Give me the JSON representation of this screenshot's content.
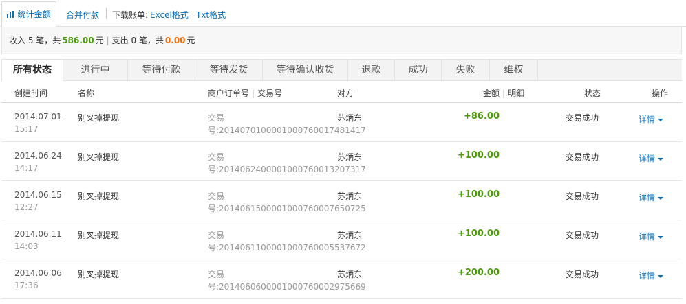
{
  "toolbar": {
    "stats_label": "统计金额",
    "merge_pay": "合并付款",
    "download_label": "下载账单:",
    "excel": "Excel格式",
    "txt": "Txt格式"
  },
  "summary": {
    "income_prefix": "收入 5 笔，共",
    "income_amount": "586.00",
    "income_unit": "元",
    "expense_prefix": "支出 0 笔，共",
    "expense_amount": "0.00",
    "expense_unit": "元"
  },
  "tabs": [
    {
      "label": "所有状态",
      "active": true
    },
    {
      "label": "进行中"
    },
    {
      "label": "等待付款"
    },
    {
      "label": "等待发货"
    },
    {
      "label": "等待确认收货"
    },
    {
      "label": "退款"
    },
    {
      "label": "成功"
    },
    {
      "label": "失败"
    },
    {
      "label": "维权"
    }
  ],
  "columns": {
    "created": "创建时间",
    "name": "名称",
    "merchant_order": "商户订单号",
    "trade_no": "交易号",
    "counterparty": "对方",
    "amount": "金额",
    "detail": "明细",
    "status": "状态",
    "action": "操作"
  },
  "rows": [
    {
      "date": "2014.07.01",
      "time": "15:17",
      "name": "别叉掉提现",
      "order": "交易号:2014070100001000760017481417",
      "party": "苏炳东",
      "amount": "+86.00",
      "status": "交易成功",
      "action": "详情"
    },
    {
      "date": "2014.06.24",
      "time": "14:17",
      "name": "别叉掉提现",
      "order": "交易号:2014062400001000760013207317",
      "party": "苏炳东",
      "amount": "+100.00",
      "status": "交易成功",
      "action": "详情"
    },
    {
      "date": "2014.06.15",
      "time": "12:27",
      "name": "别叉掉提现",
      "order": "交易号:2014061500001000760007650725",
      "party": "苏炳东",
      "amount": "+100.00",
      "status": "交易成功",
      "action": "详情"
    },
    {
      "date": "2014.06.11",
      "time": "14:03",
      "name": "别叉掉提现",
      "order": "交易号:2014061100001000760005537672",
      "party": "苏炳东",
      "amount": "+100.00",
      "status": "交易成功",
      "action": "详情"
    },
    {
      "date": "2014.06.06",
      "time": "17:36",
      "name": "别叉掉提现",
      "order": "交易号:2014060600001000760002975669",
      "party": "苏炳东",
      "amount": "+200.00",
      "status": "交易成功",
      "action": "详情"
    }
  ],
  "colors": {
    "link": "#0a6fb8",
    "income": "#4c9a0c",
    "expense": "#f0700f"
  }
}
